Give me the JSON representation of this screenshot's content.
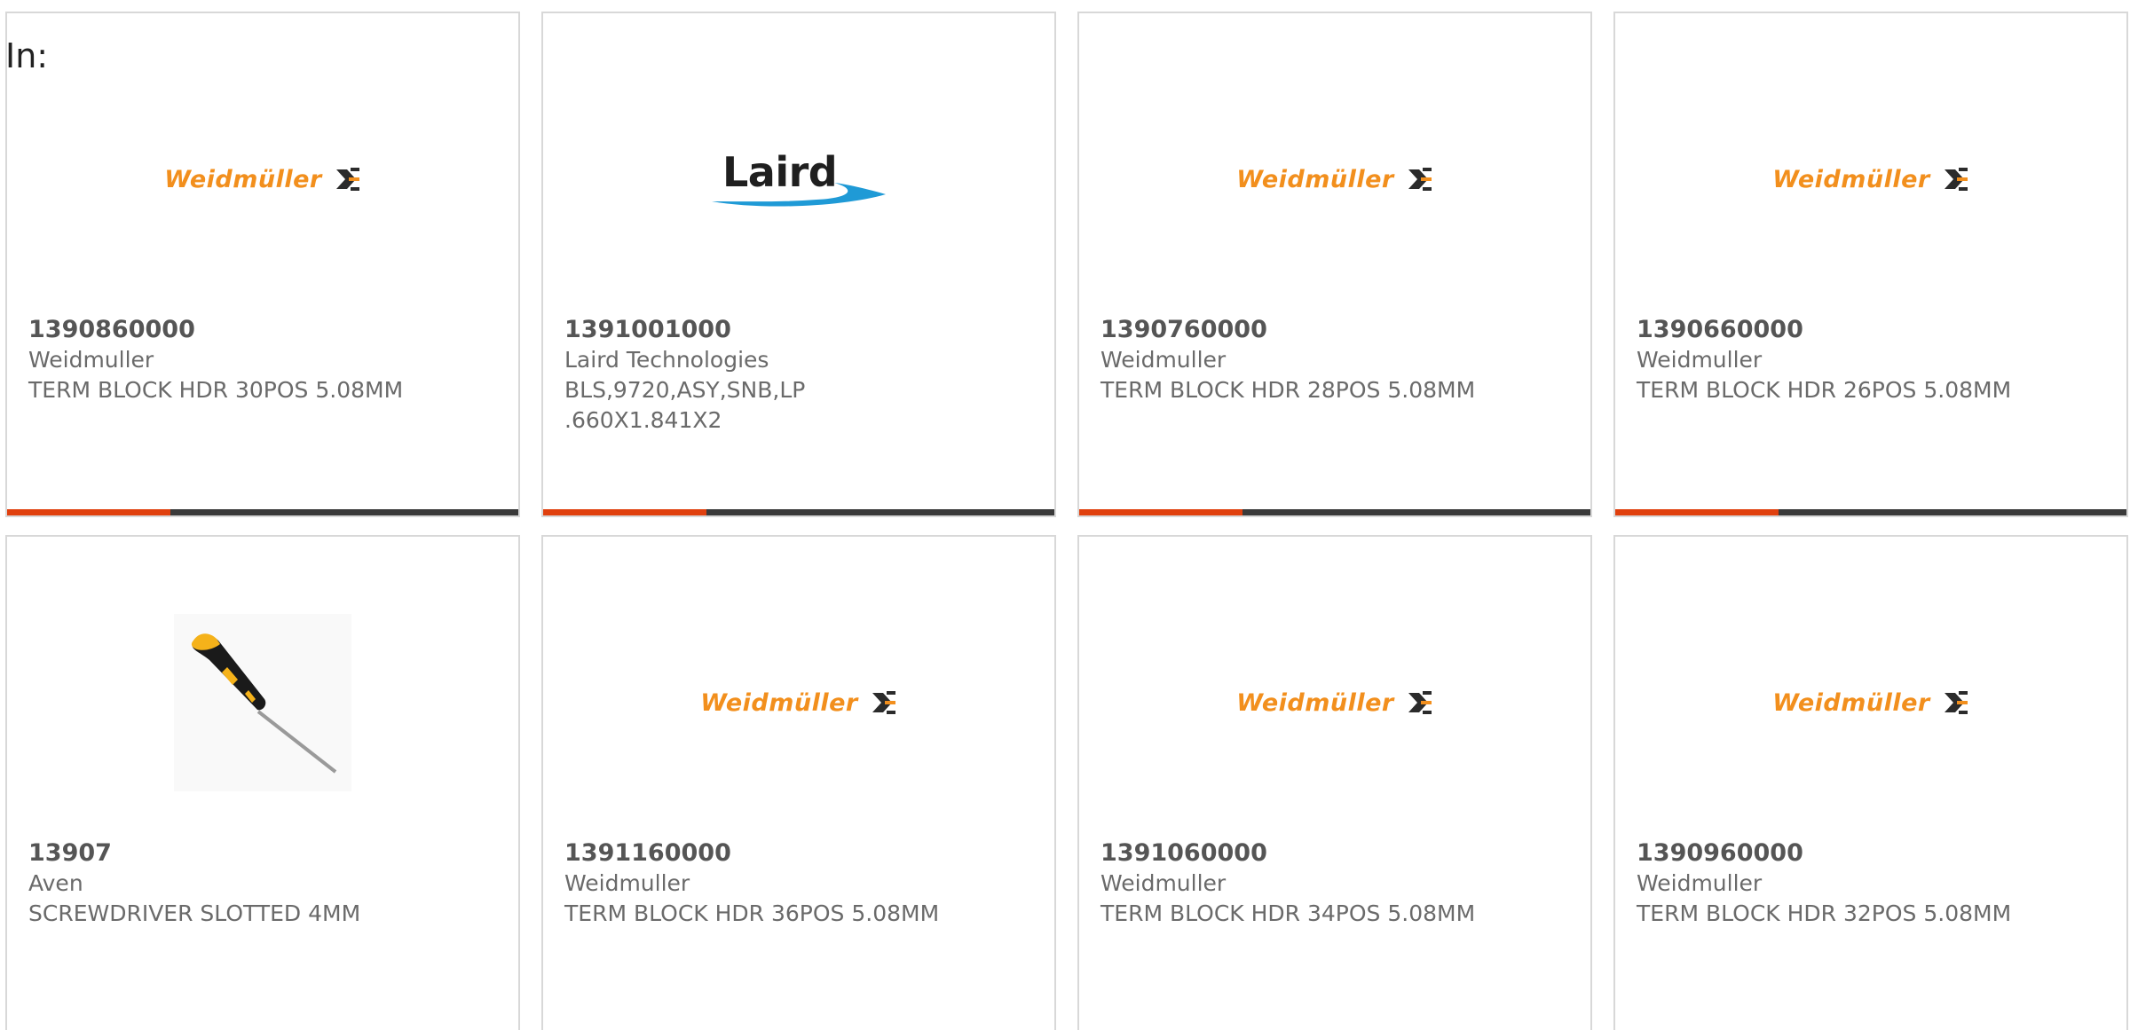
{
  "filter": {
    "label": "In:"
  },
  "colors": {
    "accent_bar": "#e0400e",
    "track_bar": "#3a3a3a",
    "weidmuller_orange": "#f28f1d",
    "laird_blue": "#1f9ad6"
  },
  "products": [
    {
      "part_number": "1390860000",
      "manufacturer": "Weidmuller",
      "description": "TERM BLOCK HDR 30POS 5.08MM",
      "image": "weidmuller-logo",
      "logo_text": "Weidmüller",
      "progress": 0.32
    },
    {
      "part_number": "1391001000",
      "manufacturer": "Laird Technologies",
      "description": "BLS,9720,ASY,SNB,LP\n.660X1.841X2",
      "image": "laird-logo",
      "logo_text": "Laird",
      "progress": 0.32
    },
    {
      "part_number": "1390760000",
      "manufacturer": "Weidmuller",
      "description": "TERM BLOCK HDR 28POS 5.08MM",
      "image": "weidmuller-logo",
      "logo_text": "Weidmüller",
      "progress": 0.32
    },
    {
      "part_number": "1390660000",
      "manufacturer": "Weidmuller",
      "description": "TERM BLOCK HDR 26POS 5.08MM",
      "image": "weidmuller-logo",
      "logo_text": "Weidmüller",
      "progress": 0.32
    },
    {
      "part_number": "13907",
      "manufacturer": "Aven",
      "description": "SCREWDRIVER SLOTTED 4MM",
      "image": "screwdriver-photo",
      "logo_text": "",
      "progress": 0
    },
    {
      "part_number": "1391160000",
      "manufacturer": "Weidmuller",
      "description": "TERM BLOCK HDR 36POS 5.08MM",
      "image": "weidmuller-logo",
      "logo_text": "Weidmüller",
      "progress": 0
    },
    {
      "part_number": "1391060000",
      "manufacturer": "Weidmuller",
      "description": "TERM BLOCK HDR 34POS 5.08MM",
      "image": "weidmuller-logo",
      "logo_text": "Weidmüller",
      "progress": 0
    },
    {
      "part_number": "1390960000",
      "manufacturer": "Weidmuller",
      "description": "TERM BLOCK HDR 32POS 5.08MM",
      "image": "weidmuller-logo",
      "logo_text": "Weidmüller",
      "progress": 0
    }
  ]
}
